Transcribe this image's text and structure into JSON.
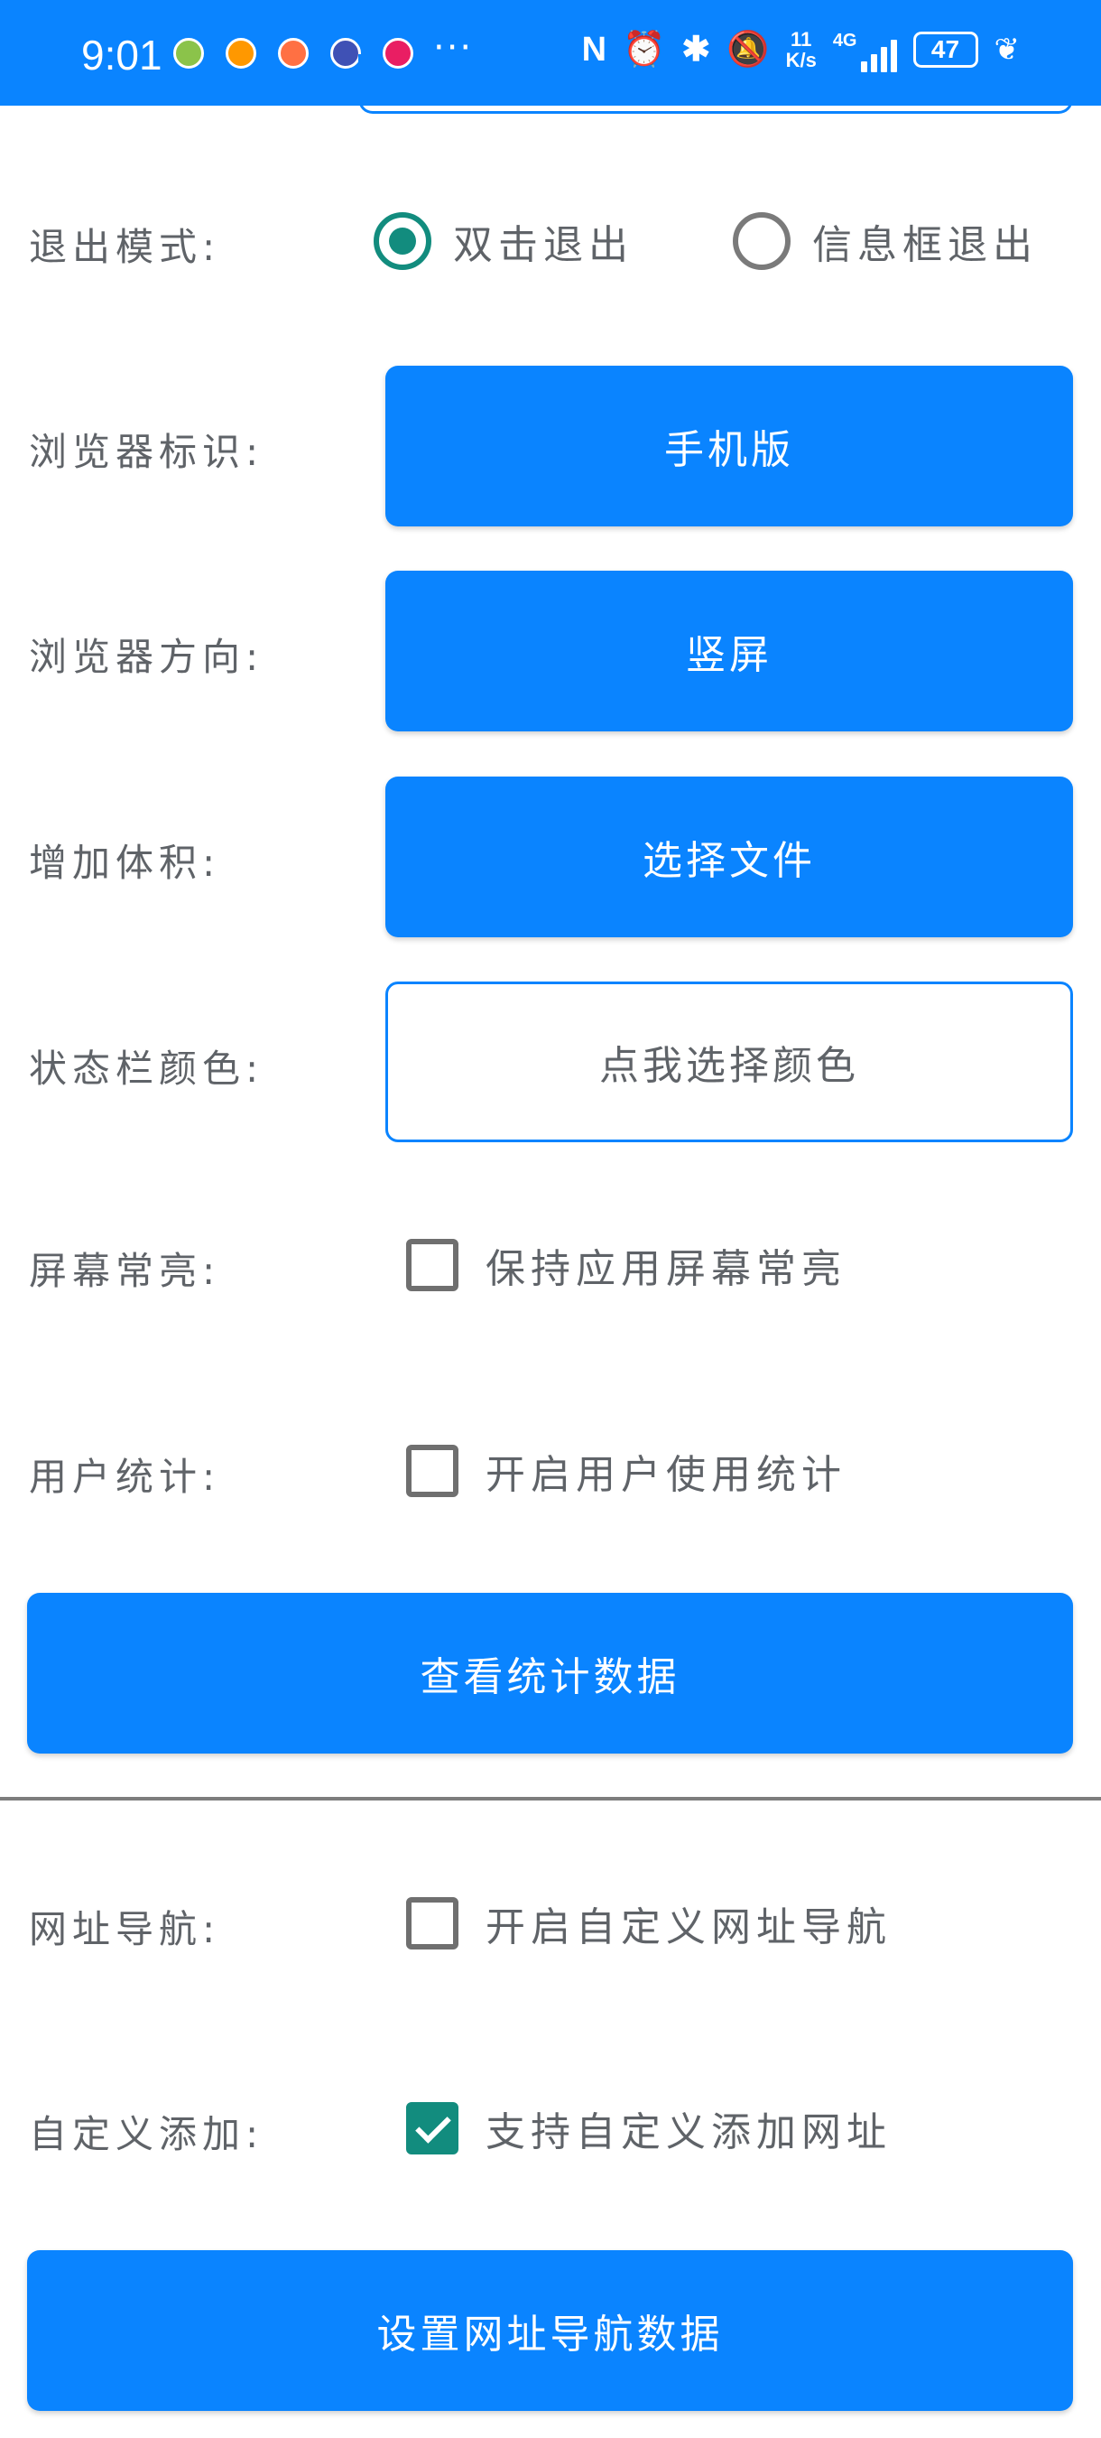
{
  "status_bar": {
    "time": "9:01",
    "more": "···",
    "net_speed_value": "11",
    "net_speed_unit": "K/s",
    "network_type": "4G",
    "battery": "47",
    "notification_colors": [
      "#8bc34a",
      "#ff9800",
      "#ff7043",
      "#3f51b5",
      "#e91e63"
    ]
  },
  "settings": {
    "exit_mode": {
      "label": "退出模式:",
      "options": [
        "双击退出",
        "信息框退出"
      ],
      "selected": "双击退出"
    },
    "browser_ua": {
      "label": "浏览器标识:",
      "value": "手机版"
    },
    "browser_orientation": {
      "label": "浏览器方向:",
      "value": "竖屏"
    },
    "increase_size": {
      "label": "增加体积:",
      "button": "选择文件"
    },
    "status_bar_color": {
      "label": "状态栏颜色:",
      "button": "点我选择颜色"
    },
    "keep_screen_on": {
      "label": "屏幕常亮:",
      "checkbox": "保持应用屏幕常亮",
      "checked": false
    },
    "user_stats": {
      "label": "用户统计:",
      "checkbox": "开启用户使用统计",
      "checked": false
    },
    "view_stats_button": "查看统计数据",
    "url_nav": {
      "label": "网址导航:",
      "checkbox": "开启自定义网址导航",
      "checked": false
    },
    "custom_add": {
      "label": "自定义添加:",
      "checkbox": "支持自定义添加网址",
      "checked": true
    },
    "set_nav_button": "设置网址导航数据"
  },
  "colors": {
    "accent": "#0a84ff",
    "check_green": "#128c7e"
  }
}
